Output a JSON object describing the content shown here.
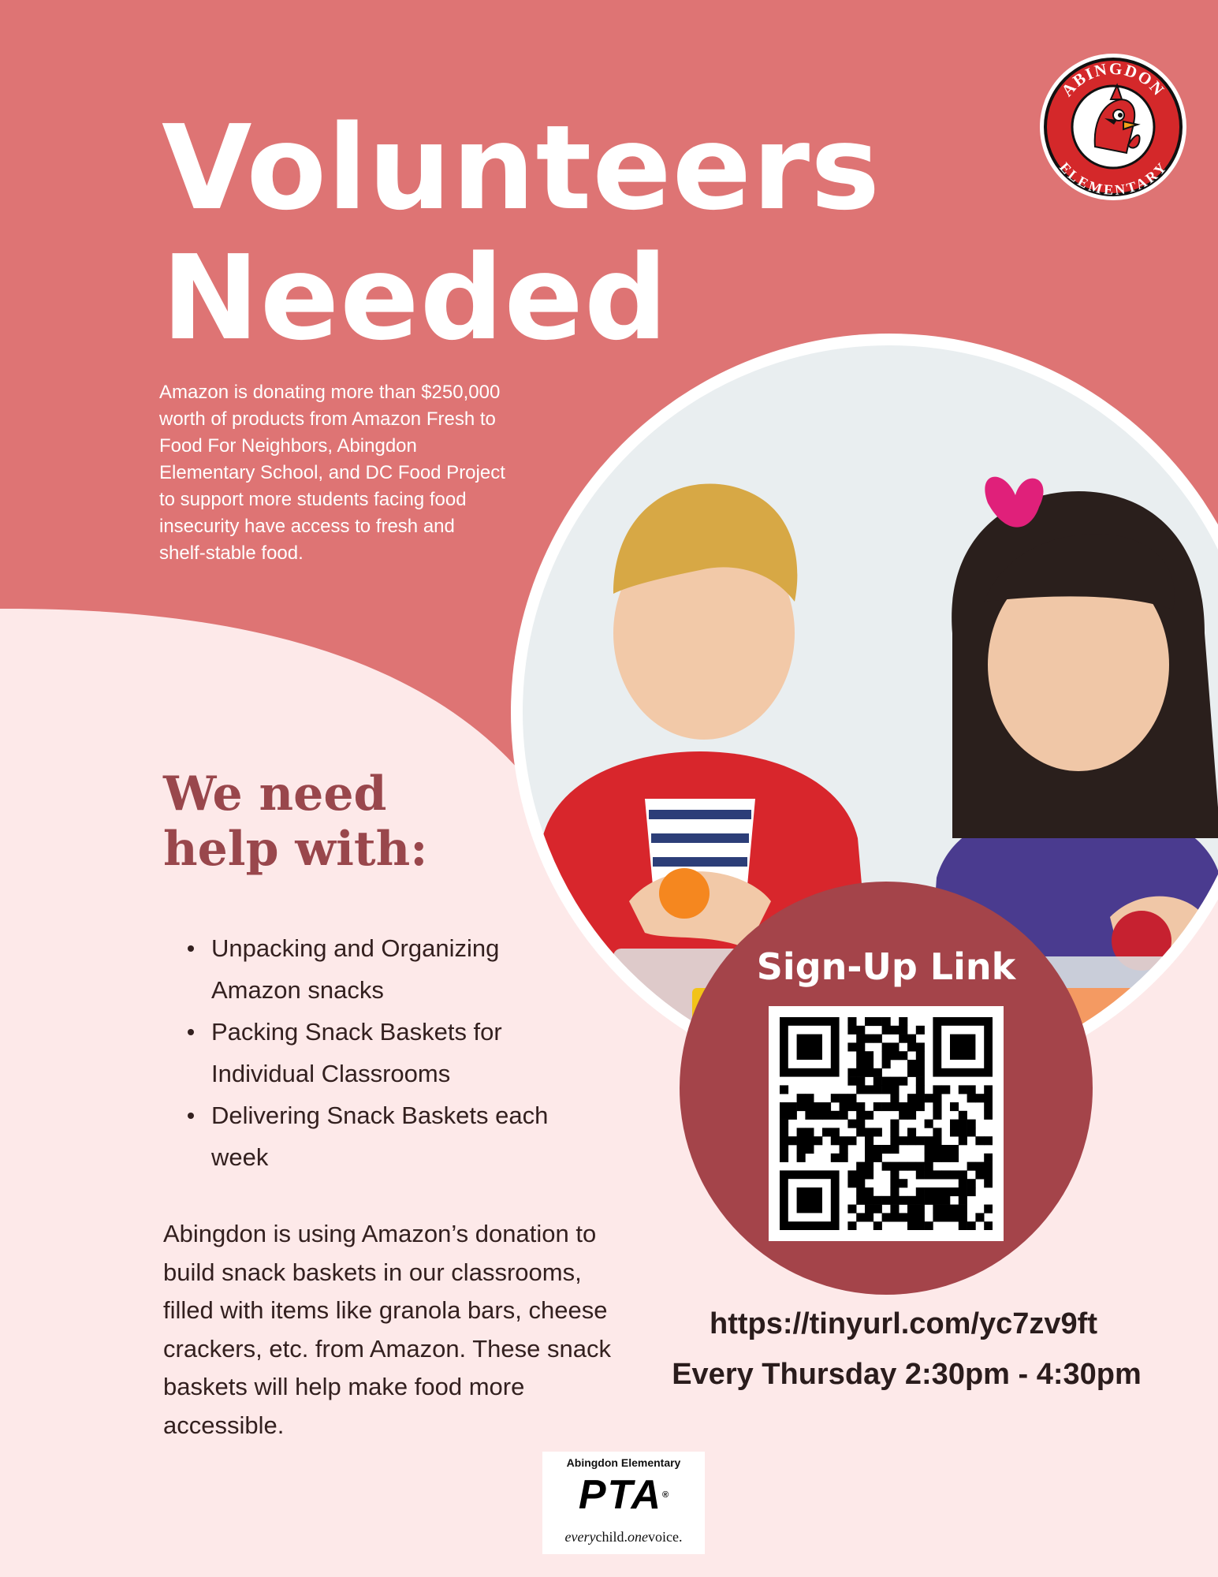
{
  "colors": {
    "header_pink": "#de7474",
    "light_pink": "#fde9e9",
    "heading_maroon": "#99474c",
    "signup_circle": "#a4444a",
    "body_text": "#33201f"
  },
  "header": {
    "title_line1": "Volunteers",
    "title_line2": "Needed",
    "intro_text": "Amazon is donating more than $250,000 worth of products from Amazon Fresh to Food For Neighbors, Abingdon Elementary School, and DC Food Project to support more students facing food insecurity have access to fresh and shelf-stable food."
  },
  "seal": {
    "top_text": "ABINGDON",
    "bottom_text": "ELEMENTARY",
    "icon": "cardinal-mascot-icon"
  },
  "help": {
    "heading_line1": "We need",
    "heading_line2": "help with:",
    "items": [
      "Unpacking and Organizing Amazon snacks",
      "Packing Snack Baskets for Individual Classrooms",
      "Delivering Snack Baskets each week"
    ],
    "description": "Abingdon is using Amazon’s donation to build snack baskets in our classrooms, filled with items like granola bars, cheese crackers, etc. from Amazon. These snack baskets will help make food more accessible."
  },
  "signup": {
    "title": "Sign-Up Link",
    "qr_icon": "qr-code-icon",
    "url": "https://tinyurl.com/yc7zv9ft",
    "schedule": "Every Thursday 2:30pm - 4:30pm"
  },
  "pta": {
    "school": "Abingdon Elementary",
    "mark": "PTA",
    "tagline_every": "every",
    "tagline_child": "child.",
    "tagline_one": "one",
    "tagline_voice": "voice."
  }
}
